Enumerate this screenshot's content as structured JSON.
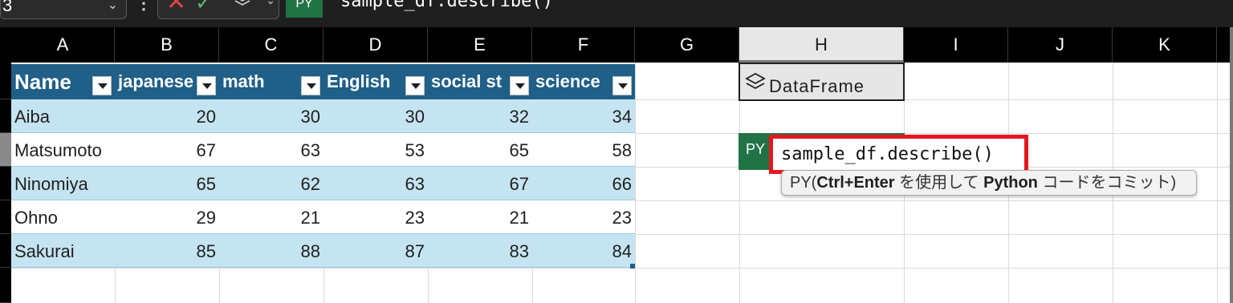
{
  "formula_bar": {
    "name_box": "3",
    "more": "⋮",
    "cancel_icon": "x-icon",
    "enter_icon": "check-icon",
    "py_label": "PY",
    "formula": "sample_df.describe()"
  },
  "columns": [
    "A",
    "B",
    "C",
    "D",
    "E",
    "F",
    "G",
    "H",
    "I",
    "J",
    "K"
  ],
  "active_column": "H",
  "table": {
    "headers": [
      "Name",
      "japanese",
      "math",
      "English",
      "social st",
      "science"
    ],
    "rows": [
      {
        "name": "Aiba",
        "values": [
          "20",
          "30",
          "30",
          "32",
          "34"
        ]
      },
      {
        "name": "Matsumoto",
        "values": [
          "67",
          "63",
          "53",
          "65",
          "58"
        ]
      },
      {
        "name": "Ninomiya",
        "values": [
          "65",
          "62",
          "63",
          "67",
          "66"
        ]
      },
      {
        "name": "Ohno",
        "values": [
          "29",
          "21",
          "23",
          "21",
          "23"
        ]
      },
      {
        "name": "Sakurai",
        "values": [
          "85",
          "88",
          "87",
          "83",
          "84"
        ]
      }
    ]
  },
  "dataframe_cell": {
    "icon": "layers-icon",
    "label": "DataFrame"
  },
  "py_editor": {
    "badge": "PY",
    "text": "sample_df.describe()"
  },
  "tooltip": {
    "prefix": "PY(",
    "shortcut": "Ctrl+Enter",
    "mid": " を使用して ",
    "lang": "Python",
    "suffix": " コードをコミット)"
  },
  "colors": {
    "table_header": "#1f5f88",
    "band": "#c5e4f2",
    "py_green": "#217346",
    "highlight_red": "#e5171f"
  }
}
